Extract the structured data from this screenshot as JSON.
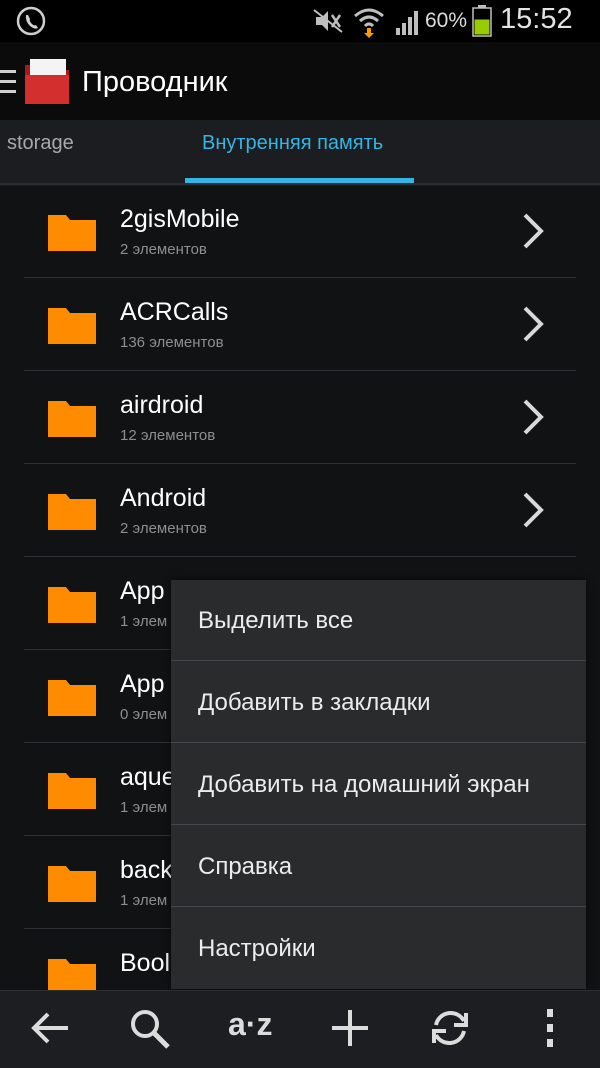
{
  "status_bar": {
    "battery_percent": "60%",
    "battery_level": 0.6,
    "time": "15:52",
    "icons": [
      "phone-icon",
      "silent-mode-icon",
      "wifi-icon",
      "signal-icon",
      "battery-icon"
    ]
  },
  "action_bar": {
    "title": "Проводник",
    "icons": [
      "drawer-menu-icon",
      "app-logo-icon"
    ]
  },
  "tabs": [
    {
      "label": "storage",
      "selected": false
    },
    {
      "label": "Внутренняя память",
      "selected": true
    }
  ],
  "files": [
    {
      "name": "2gisMobile",
      "count": "2 элементов"
    },
    {
      "name": "ACRCalls",
      "count": "136 элементов"
    },
    {
      "name": "airdroid",
      "count": "12 элементов"
    },
    {
      "name": "Android",
      "count": "2 элементов"
    },
    {
      "name": "App",
      "count": "1 элем"
    },
    {
      "name": "App",
      "count": "0 элем"
    },
    {
      "name": "aque",
      "count": "1 элем"
    },
    {
      "name": "back",
      "count": "1 элем"
    },
    {
      "name": "Bool",
      "count": ""
    }
  ],
  "menu": {
    "items": [
      "Выделить все",
      "Добавить в закладки",
      "Добавить на домашний экран",
      "Справка",
      "Настройки"
    ]
  },
  "bottom_bar": {
    "sort_label": "a·z",
    "icons": [
      "back-arrow-icon",
      "search-icon",
      "sort-az-icon",
      "add-icon",
      "refresh-icon",
      "overflow-menu-icon"
    ]
  },
  "colors": {
    "accent": "#33b5e5",
    "folder": "#ff8c00",
    "logo": "#d32f2f",
    "battery": "#99cc00"
  }
}
